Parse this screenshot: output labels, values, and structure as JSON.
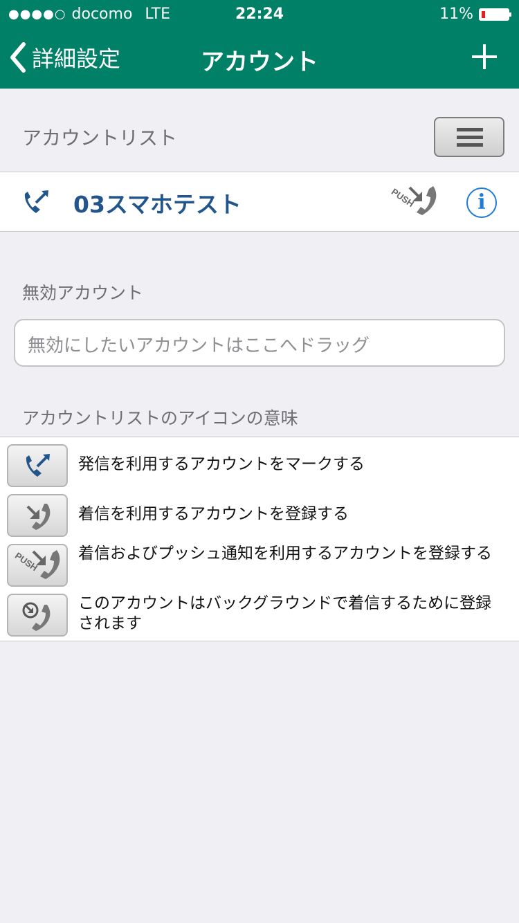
{
  "statusbar": {
    "signal": "●●●●○",
    "carrier": "docomo",
    "network": "LTE",
    "time": "22:24",
    "battery_percent": "11%",
    "battery_level": 0.11
  },
  "navbar": {
    "back_label": "詳細設定",
    "title": "アカウント"
  },
  "account_list": {
    "header": "アカウントリスト",
    "accounts": [
      {
        "name": "03スマホテスト"
      }
    ]
  },
  "disabled_accounts": {
    "header": "無効アカウント",
    "drop_placeholder": "無効にしたいアカウントはここへドラッグ"
  },
  "legend": {
    "header": "アカウントリストのアイコンの意味",
    "items": [
      {
        "icon": "outgoing-call-icon",
        "text": "発信を利用するアカウントをマークする"
      },
      {
        "icon": "incoming-call-icon",
        "text": "着信を利用するアカウントを登録する"
      },
      {
        "icon": "push-incoming-call-icon",
        "text": "着信およびプッシュ通知を利用するアカウントを登録する"
      },
      {
        "icon": "background-incoming-call-icon",
        "text": "このアカウントはバックグラウンドで着信するために登録されます"
      }
    ]
  },
  "colors": {
    "nav_background": "#008067",
    "account_name": "#22558c",
    "info_button": "#1e7bd8",
    "page_background": "#efeff4"
  }
}
